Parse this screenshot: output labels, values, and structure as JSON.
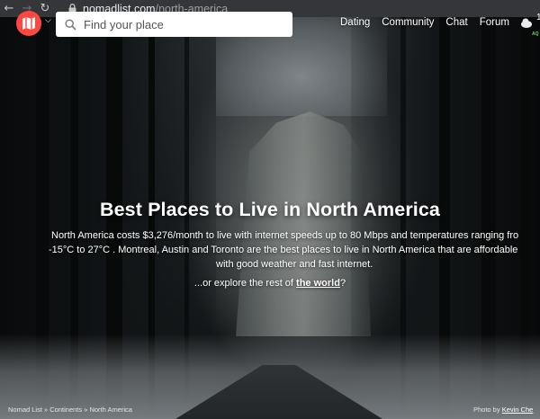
{
  "browser": {
    "url_host": "nomadlist.com",
    "url_path": "/north-america"
  },
  "header": {
    "search_placeholder": "Find your place",
    "nav": [
      {
        "label": "Dating"
      },
      {
        "label": "Community"
      },
      {
        "label": "Chat"
      },
      {
        "label": "Forum"
      }
    ],
    "weather": {
      "icon": "cloud-icon",
      "value": "1",
      "aq": "AQ"
    },
    "brand_color": "#ff4742"
  },
  "hero": {
    "title": "Best Places to Live in North America",
    "desc_line1": "North America costs $3,276/month to live with internet speeds up to 80 Mbps and temperatures ranging fro",
    "desc_line2": "-15°C to 27°C . Montreal, Austin and Toronto are the best places to live in North America that are affordable",
    "desc_line3": "with good weather and fast internet.",
    "explore_prefix": "...or explore the rest of ",
    "explore_link": "the world",
    "explore_suffix": "?"
  },
  "footer": {
    "breadcrumb": "Nomad List » Continents » North America",
    "credit_prefix": "Photo by ",
    "credit_link": "Kevin Che"
  }
}
